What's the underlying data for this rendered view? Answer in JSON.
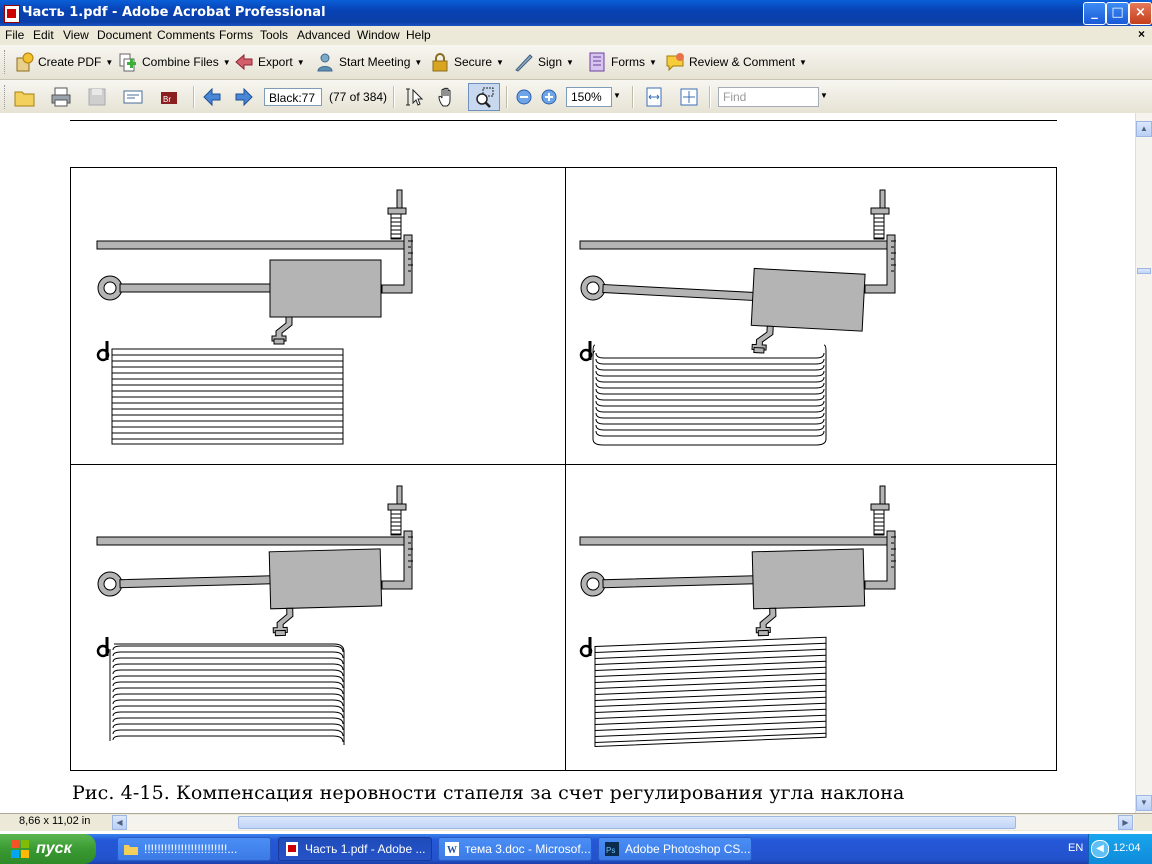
{
  "window": {
    "title": "Часть 1.pdf - Adobe Acrobat Professional",
    "buttons": {
      "minimize": "_",
      "maximize": "□",
      "close": "×"
    }
  },
  "menu": {
    "items": [
      "File",
      "Edit",
      "View",
      "Document",
      "Comments",
      "Forms",
      "Tools",
      "Advanced",
      "Window",
      "Help"
    ],
    "close_glyph": "×"
  },
  "toolbar": {
    "tasks": [
      {
        "label": "Create PDF",
        "icon": "create-pdf-icon"
      },
      {
        "label": "Combine Files",
        "icon": "combine-files-icon"
      },
      {
        "label": "Export",
        "icon": "export-icon"
      },
      {
        "label": "Start Meeting",
        "icon": "meeting-icon"
      },
      {
        "label": "Secure",
        "icon": "lock-icon"
      },
      {
        "label": "Sign",
        "icon": "pen-icon"
      },
      {
        "label": "Forms",
        "icon": "forms-icon"
      },
      {
        "label": "Review & Comment",
        "icon": "comment-icon"
      }
    ]
  },
  "nav": {
    "page_field": "Black:77",
    "page_count": "(77 of 384)",
    "zoom": "150%",
    "find_placeholder": "Find"
  },
  "document": {
    "caption": "Рис. 4-15. Компенсация неровности стапеля за счет регулирования угла наклона",
    "figure_cells": 4
  },
  "status": {
    "page_size": "8,66 x 11,02 in"
  },
  "taskbar": {
    "start_label": "пуск",
    "tasks": [
      {
        "label": "!!!!!!!!!!!!!!!!!!!!!!!!!...",
        "active": false,
        "icon": "folder-icon"
      },
      {
        "label": "Часть 1.pdf - Adobe ...",
        "active": true,
        "icon": "pdf-icon"
      },
      {
        "label": "тема 3.doc - Microsof...",
        "active": false,
        "icon": "word-icon"
      },
      {
        "label": "Adobe Photoshop CS...",
        "active": false,
        "icon": "photoshop-icon"
      }
    ],
    "lang": "EN",
    "clock": "12:04"
  },
  "colors": {
    "titlebar": "#0842b4",
    "menubar": "#ece9d8",
    "taskbar": "#2458d8",
    "start": "#3a9a32",
    "figure_gray": "#b4b4b4"
  }
}
